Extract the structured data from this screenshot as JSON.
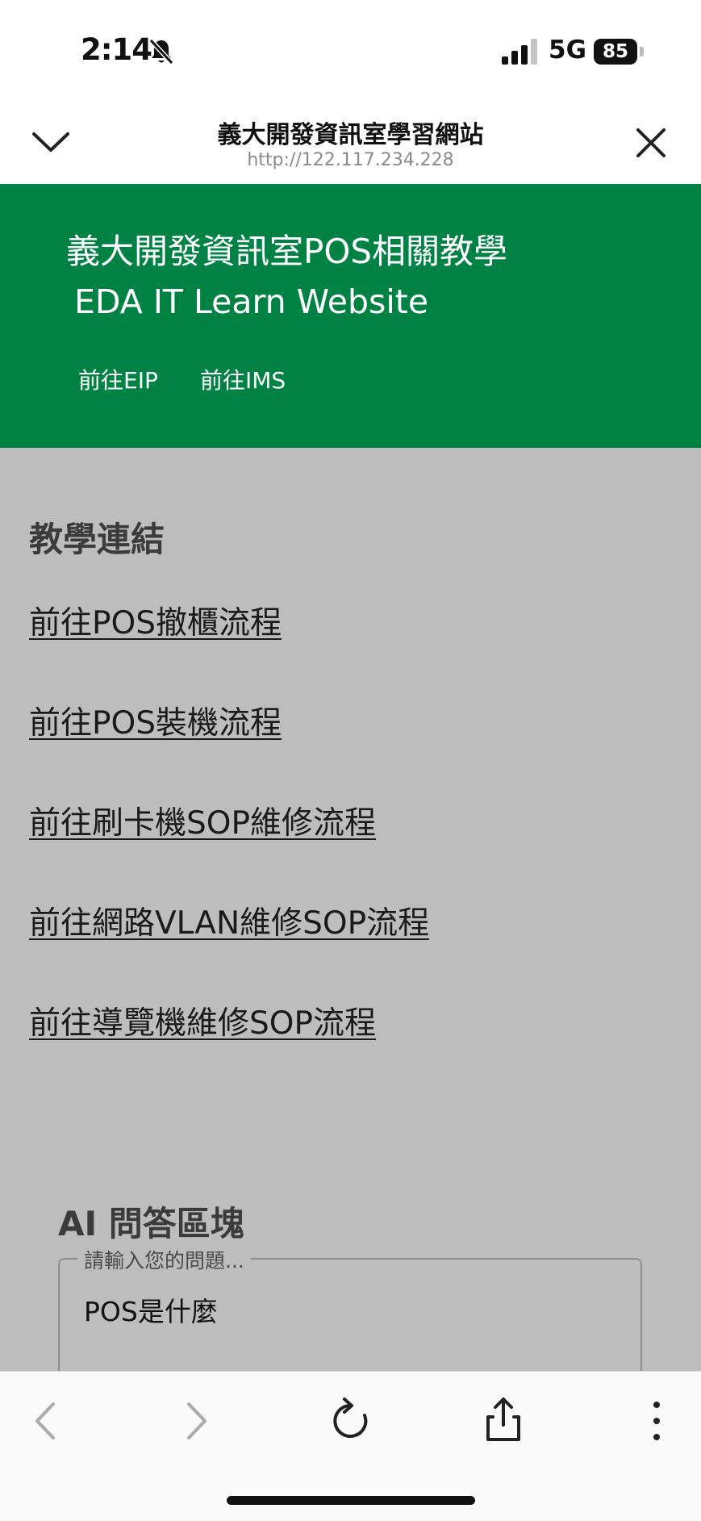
{
  "status_bar": {
    "time": "2:14",
    "network": "5G",
    "battery_level": "85",
    "icons": [
      "bell-muted-icon",
      "signal-icon",
      "battery-icon"
    ]
  },
  "browser": {
    "title": "義大開發資訊室學習網站",
    "url": "http://122.117.234.228",
    "icons": [
      "chevron-down-icon",
      "close-icon",
      "back-icon",
      "forward-icon",
      "reload-icon",
      "share-icon",
      "more-icon"
    ]
  },
  "banner": {
    "title_zh": "義大開發資訊室POS相關教學",
    "title_en": "EDA IT Learn Website",
    "links": [
      "前往EIP",
      "前往IMS"
    ],
    "background": "#008244"
  },
  "tutorials": {
    "heading": "教學連結",
    "links": [
      "前往POS撤櫃流程",
      "前往POS裝機流程",
      "前往刷卡機SOP維修流程",
      "前往網路VLAN維修SOP流程",
      "前往導覽機維修SOP流程"
    ]
  },
  "ai_section": {
    "heading": "AI 問答區塊",
    "input_label": "請輸入您的問題...",
    "input_value": "POS是什麼"
  }
}
